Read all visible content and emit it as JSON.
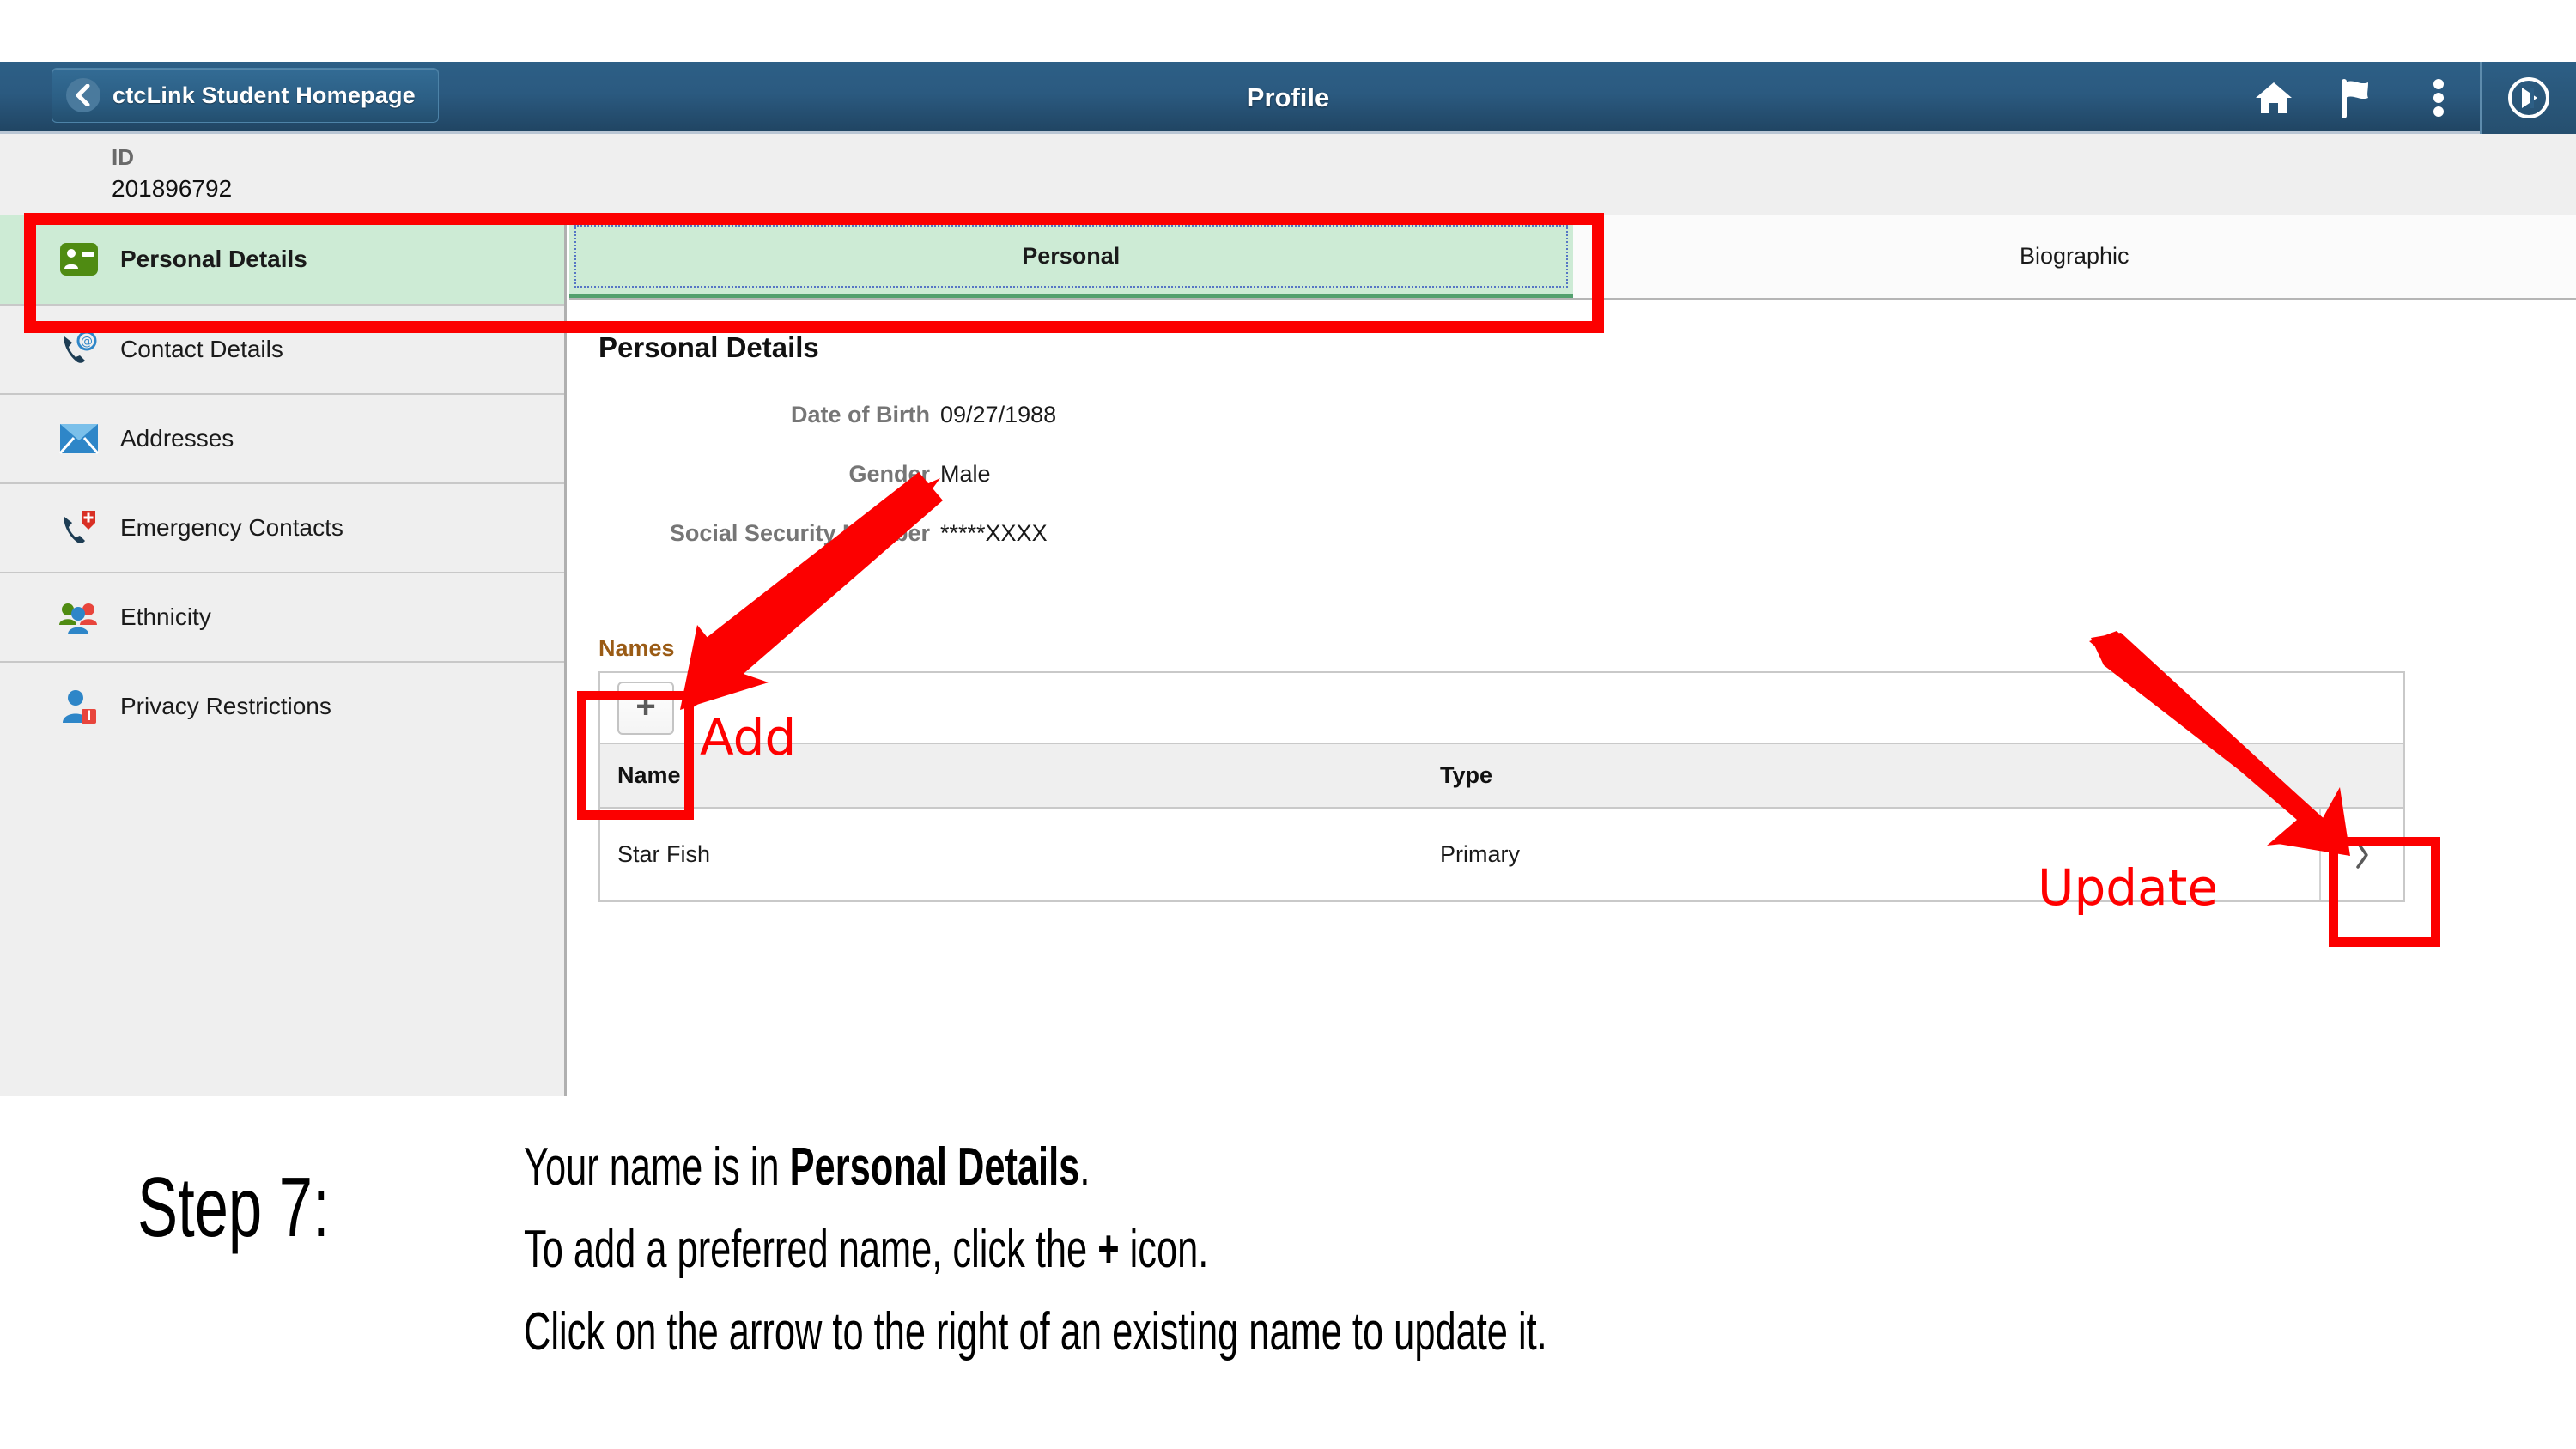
{
  "header": {
    "back_label": "ctcLink Student Homepage",
    "title": "Profile",
    "icons": [
      {
        "name": "home-icon"
      },
      {
        "name": "flag-icon"
      },
      {
        "name": "actions-menu-icon"
      },
      {
        "name": "navbar-icon"
      }
    ]
  },
  "id_strip": {
    "label": "ID",
    "value": "201896792"
  },
  "sidebar": {
    "items": [
      {
        "label": "Personal Details",
        "icon": "id-card-icon",
        "active": true
      },
      {
        "label": "Contact Details",
        "icon": "phone-at-icon",
        "active": false
      },
      {
        "label": "Addresses",
        "icon": "envelope-icon",
        "active": false
      },
      {
        "label": "Emergency Contacts",
        "icon": "phone-medical-icon",
        "active": false
      },
      {
        "label": "Ethnicity",
        "icon": "people-group-icon",
        "active": false
      },
      {
        "label": "Privacy Restrictions",
        "icon": "person-info-icon",
        "active": false
      }
    ]
  },
  "tabs": [
    {
      "label": "Personal",
      "active": true
    },
    {
      "label": "Biographic",
      "active": false
    }
  ],
  "main": {
    "section_title": "Personal Details",
    "fields": [
      {
        "label": "Date of Birth",
        "value": "09/27/1988"
      },
      {
        "label": "Gender",
        "value": "Male"
      },
      {
        "label": "Social Security Number",
        "value": "*****XXXX"
      }
    ],
    "names_label": "Names",
    "add_button_glyph": "+",
    "grid": {
      "columns": [
        "Name",
        "Type"
      ],
      "rows": [
        {
          "name": "Star Fish",
          "type": "Primary",
          "chevron": "›"
        }
      ]
    }
  },
  "annotations": {
    "add_label": "Add",
    "update_label": "Update",
    "accent_color": "#ff0000"
  },
  "caption": {
    "step": "Step 7:",
    "line1_pre": "Your name is in ",
    "line1_bold": "Personal Details",
    "line1_post": ".",
    "line2_pre": "To add a preferred name, click the ",
    "line2_bold": "+",
    "line2_post": " icon.",
    "line3": "Click on the arrow to the right of an existing name to update it."
  }
}
